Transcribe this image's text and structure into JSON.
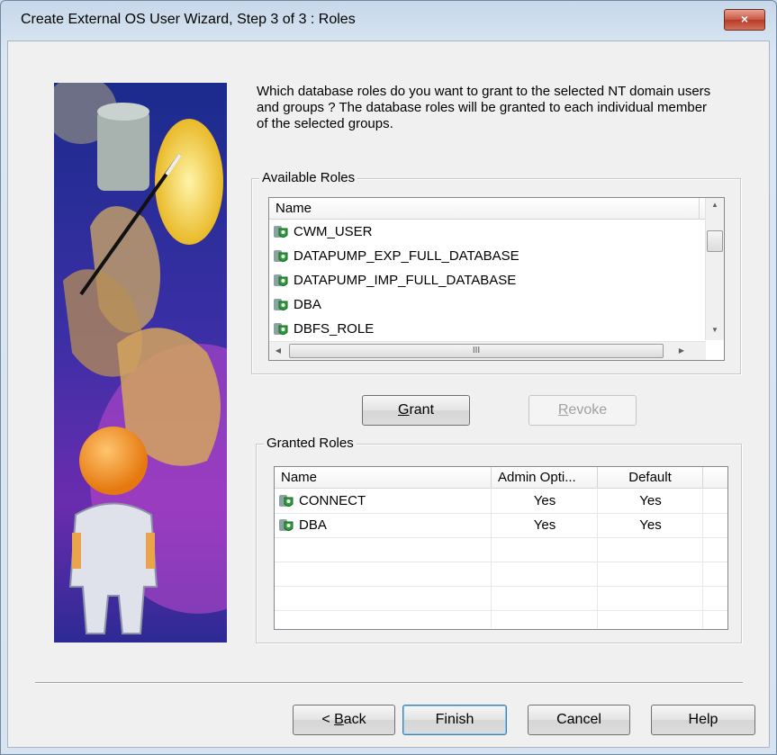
{
  "window": {
    "title": "Create External OS User Wizard, Step 3 of 3 : Roles",
    "close_glyph": "×"
  },
  "intro_text": "Which database roles do you want to grant to the selected NT domain users and groups ? The database roles will be granted to each individual member of the selected groups.",
  "available": {
    "group_label": "Available Roles",
    "column_name": "Name",
    "items": [
      "CWM_USER",
      "DATAPUMP_EXP_FULL_DATABASE",
      "DATAPUMP_IMP_FULL_DATABASE",
      "DBA",
      "DBFS_ROLE"
    ],
    "hscroll_grip": "III"
  },
  "buttons": {
    "grant": "G",
    "grant_rest": "rant",
    "revoke": "R",
    "revoke_rest": "evoke",
    "back_prefix": "< ",
    "back": "B",
    "back_rest": "ack",
    "finish": "Finish",
    "cancel": "Cancel",
    "help": "Help"
  },
  "granted": {
    "group_label": "Granted Roles",
    "columns": [
      "Name",
      "Admin Opti...",
      "Default"
    ],
    "rows": [
      {
        "name": "CONNECT",
        "admin": "Yes",
        "default": "Yes"
      },
      {
        "name": "DBA",
        "admin": "Yes",
        "default": "Yes"
      }
    ]
  },
  "icons": {
    "role": "role-icon",
    "close": "close-icon",
    "wizard": "wizard-image"
  }
}
